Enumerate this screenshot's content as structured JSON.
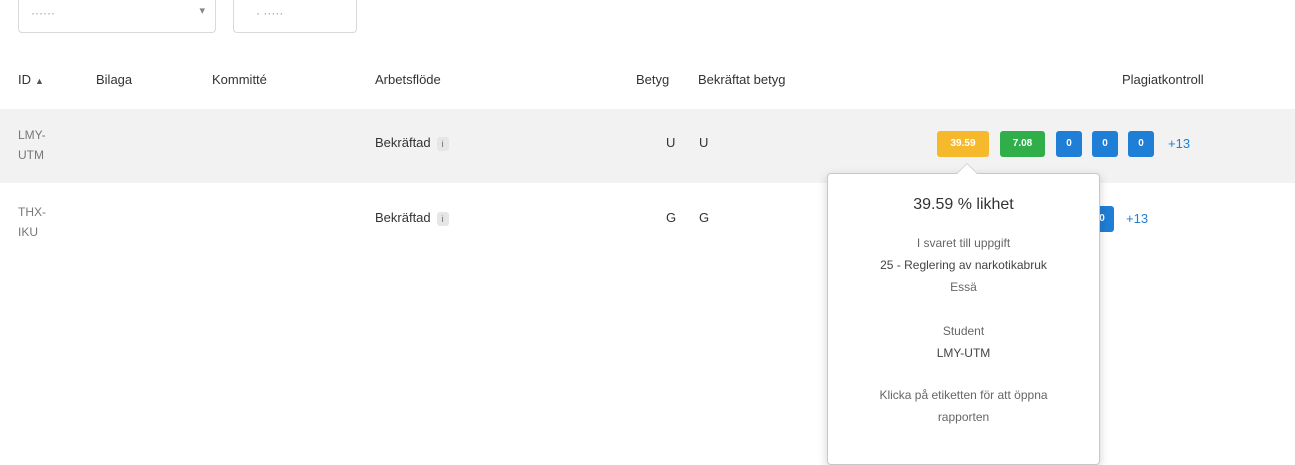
{
  "toolbar": {
    "select_value": "······",
    "filter_label": "· ·····"
  },
  "table": {
    "columns": {
      "id": "ID",
      "bilaga": "Bilaga",
      "kommitte": "Kommitté",
      "arbetsflode": "Arbetsflöde",
      "betyg": "Betyg",
      "bekraftat_betyg": "Bekräftat betyg",
      "plagiatkontroll": "Plagiatkontroll"
    },
    "rows": [
      {
        "id_line1": "LMY-",
        "id_line2": "UTM",
        "arbetsflode": "Bekräftad",
        "arbetsflode_badge": "i",
        "betyg": "U",
        "bekraftat_betyg": "U",
        "scores": [
          "39.59",
          "7.08",
          "0",
          "0",
          "0"
        ],
        "more": "+13"
      },
      {
        "id_line1": "THX-",
        "id_line2": "IKU",
        "arbetsflode": "Bekräftad",
        "arbetsflode_badge": "i",
        "betyg": "G",
        "bekraftat_betyg": "G",
        "scores": [
          "0"
        ],
        "more": "+13"
      }
    ]
  },
  "popover": {
    "title": "39.59 % likhet",
    "assignment_label": "I svaret till uppgift",
    "assignment_name": "25 - Reglering av narkotikabruk",
    "assignment_type": "Essä",
    "student_label": "Student",
    "student_id": "LMY-UTM",
    "hint_line1": "Klicka på etiketten för att öppna",
    "hint_line2": "rapporten"
  },
  "colors": {
    "yellow": "#f7b92c",
    "green": "#2fae4a",
    "blue": "#1f7ed6",
    "row_highlight": "#f2f2f2"
  }
}
